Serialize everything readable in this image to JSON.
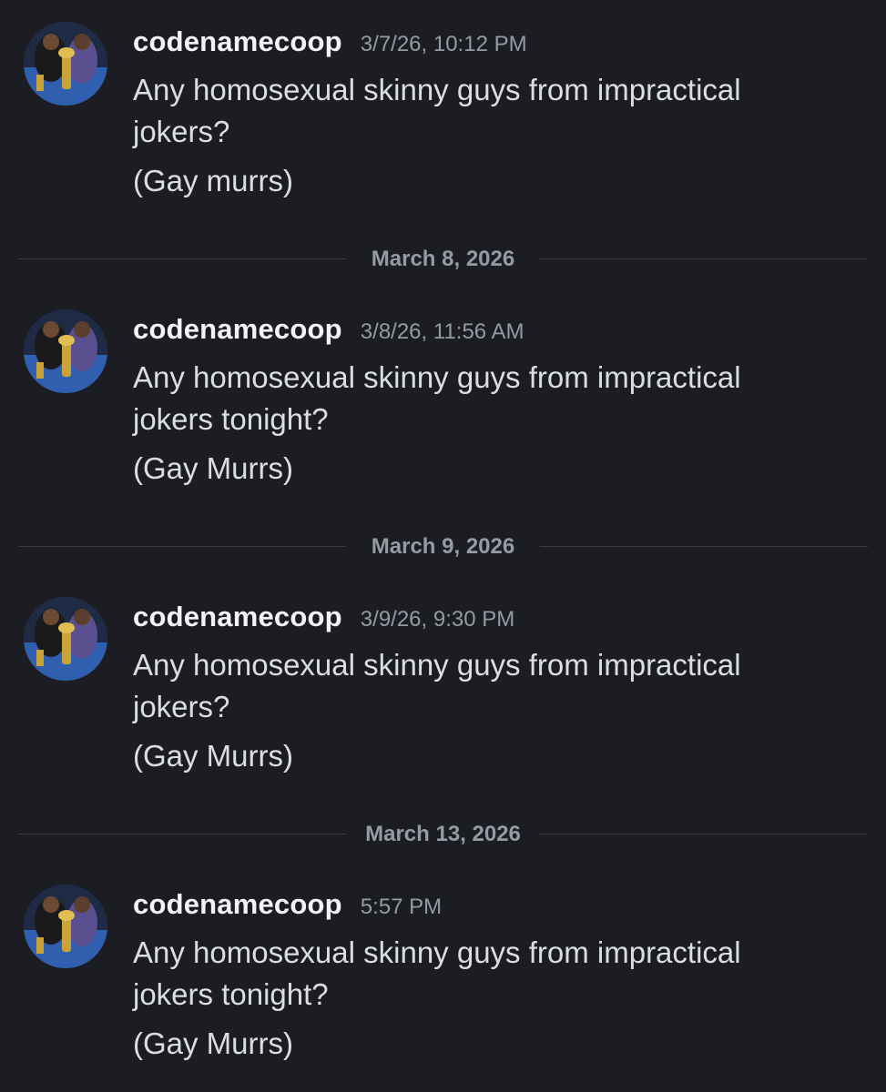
{
  "messages": [
    {
      "author": "codenamecoop",
      "timestamp": "3/7/26, 10:12 PM",
      "text_1": "Any homosexual skinny guys from impractical jokers?",
      "text_2": "(Gay murrs)"
    },
    {
      "author": "codenamecoop",
      "timestamp": "3/8/26, 11:56 AM",
      "text_1": "Any homosexual skinny guys from impractical jokers tonight?",
      "text_2": "(Gay Murrs)"
    },
    {
      "author": "codenamecoop",
      "timestamp": "3/9/26, 9:30 PM",
      "text_1": "Any homosexual skinny guys from impractical jokers?",
      "text_2": "(Gay Murrs)"
    },
    {
      "author": "codenamecoop",
      "timestamp": "5:57 PM",
      "text_1": "Any homosexual skinny guys from impractical jokers tonight?",
      "text_2": "(Gay Murrs)"
    }
  ],
  "dividers": [
    {
      "date": "March 8, 2026"
    },
    {
      "date": "March 9, 2026"
    },
    {
      "date": "March 13, 2026"
    }
  ],
  "colors": {
    "background": "#1c1d22",
    "username": "#f2f3f5",
    "message_text": "#dbdee1",
    "muted": "#949ba4",
    "divider_rule": "#3a3c43"
  }
}
